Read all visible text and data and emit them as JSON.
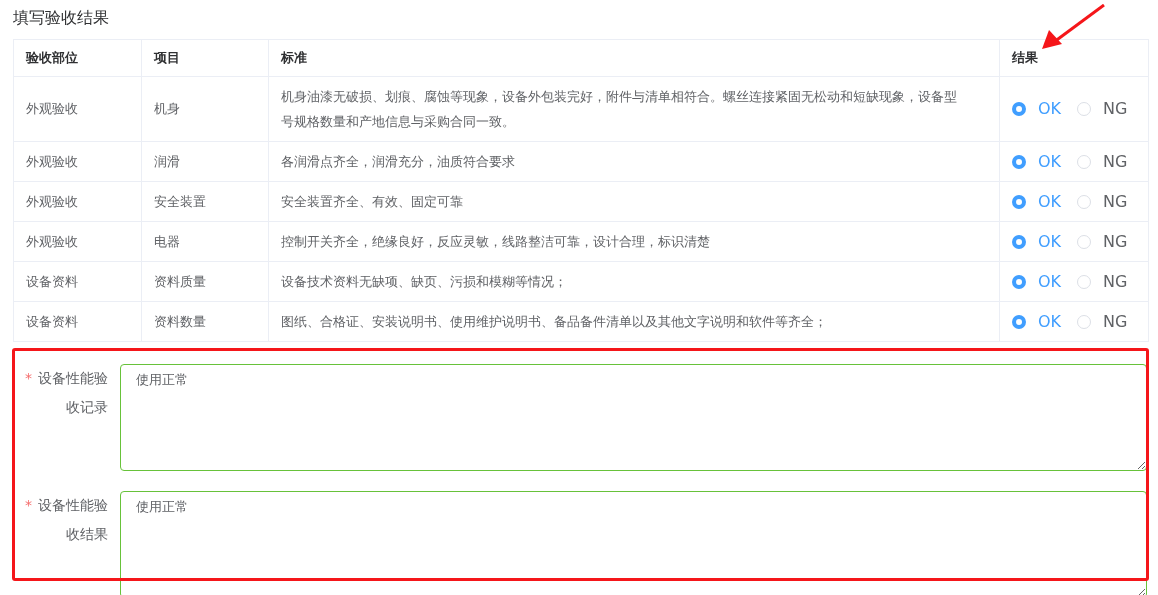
{
  "title": "填写验收结果",
  "table": {
    "columns": [
      "验收部位",
      "项目",
      "标准",
      "结果"
    ],
    "rows": [
      {
        "part": "外观验收",
        "item": "机身",
        "standard": "机身油漆无破损、划痕、腐蚀等现象，设备外包装完好，附件与清单相符合。螺丝连接紧固无松动和短缺现象，设备型号规格数量和产地信息与采购合同一致。",
        "options": [
          {
            "label": "OK",
            "selected": true
          },
          {
            "label": "NG",
            "selected": false
          }
        ]
      },
      {
        "part": "外观验收",
        "item": "润滑",
        "standard": "各润滑点齐全，润滑充分，油质符合要求",
        "options": [
          {
            "label": "OK",
            "selected": true
          },
          {
            "label": "NG",
            "selected": false
          }
        ]
      },
      {
        "part": "外观验收",
        "item": "安全装置",
        "standard": "安全装置齐全、有效、固定可靠",
        "options": [
          {
            "label": "OK",
            "selected": true
          },
          {
            "label": "NG",
            "selected": false
          }
        ]
      },
      {
        "part": "外观验收",
        "item": "电器",
        "standard": "控制开关齐全，绝缘良好，反应灵敏，线路整洁可靠，设计合理，标识清楚",
        "options": [
          {
            "label": "OK",
            "selected": true
          },
          {
            "label": "NG",
            "selected": false
          }
        ]
      },
      {
        "part": "设备资料",
        "item": "资料质量",
        "standard": "设备技术资料无缺项、缺页、污损和模糊等情况；",
        "options": [
          {
            "label": "OK",
            "selected": true
          },
          {
            "label": "NG",
            "selected": false
          }
        ]
      },
      {
        "part": "设备资料",
        "item": "资料数量",
        "standard": "图纸、合格证、安装说明书、使用维护说明书、备品备件清单以及其他文字说明和软件等齐全；",
        "options": [
          {
            "label": "OK",
            "selected": true
          },
          {
            "label": "NG",
            "selected": false
          }
        ]
      }
    ]
  },
  "fields": [
    {
      "label": "设备性能验收记录",
      "required_mark": "*",
      "value": "使用正常"
    },
    {
      "label": "设备性能验收结果",
      "required_mark": "*",
      "value": "使用正常"
    }
  ]
}
